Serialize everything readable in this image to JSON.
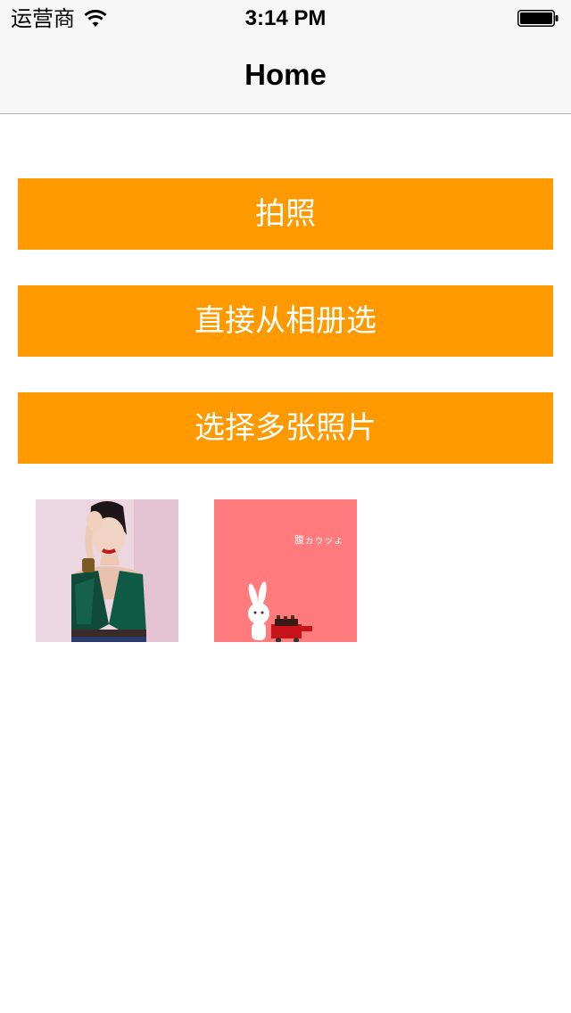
{
  "status_bar": {
    "carrier": "运营商",
    "time": "3:14 PM"
  },
  "nav": {
    "title": "Home"
  },
  "buttons": {
    "take_photo": "拍照",
    "choose_from_album": "直接从相册选",
    "choose_multiple": "选择多张照片"
  },
  "thumbnails": {
    "second_caption": "腹ヵゥッょ"
  },
  "colors": {
    "accent": "#ff9900",
    "navbar_bg": "#f7f7f7",
    "thumb_pink": "#ff7b7d"
  }
}
